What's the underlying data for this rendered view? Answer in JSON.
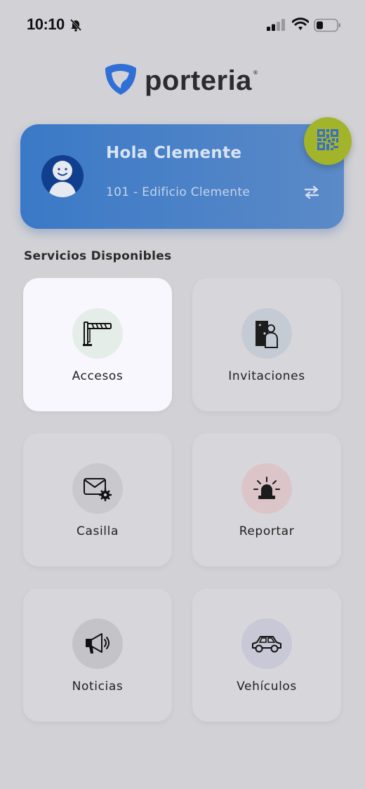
{
  "status_bar": {
    "time": "10:10"
  },
  "brand": {
    "name": "porteria",
    "registered": "®",
    "logo_color": "#2f6fd6"
  },
  "user_card": {
    "greeting": "Hola Clemente",
    "unit": "101 - Edificio Clemente",
    "accent": "#3a79c7",
    "qr_button_color": "#a1b42a"
  },
  "services": {
    "title": "Servicios Disponibles",
    "items": [
      {
        "label": "Accesos",
        "icon": "barrier-gate-icon"
      },
      {
        "label": "Invitaciones",
        "icon": "door-visitor-icon"
      },
      {
        "label": "Casilla",
        "icon": "mail-settings-icon"
      },
      {
        "label": "Reportar",
        "icon": "siren-icon"
      },
      {
        "label": "Noticias",
        "icon": "megaphone-icon"
      },
      {
        "label": "Vehículos",
        "icon": "car-icon"
      }
    ]
  }
}
